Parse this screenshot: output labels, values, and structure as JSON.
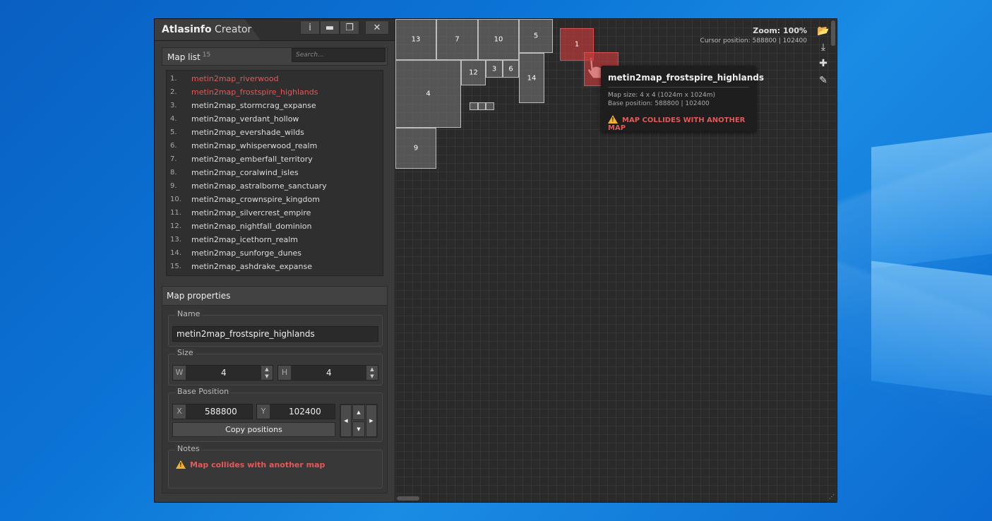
{
  "app": {
    "title_main": "Atlasinfo",
    "title_light": " Creator",
    "buttons": {
      "info": "i",
      "minimize": "▬",
      "restore": "❐",
      "close": "✕"
    }
  },
  "map_list": {
    "title": "Map list",
    "count": "15",
    "search_placeholder": "Search...",
    "items": [
      {
        "num": "1.",
        "name": "metin2map_riverwood"
      },
      {
        "num": "2.",
        "name": "metin2map_frostspire_highlands"
      },
      {
        "num": "3.",
        "name": "metin2map_stormcrag_expanse"
      },
      {
        "num": "4.",
        "name": "metin2map_verdant_hollow"
      },
      {
        "num": "5.",
        "name": "metin2map_evershade_wilds"
      },
      {
        "num": "6.",
        "name": "metin2map_whisperwood_realm"
      },
      {
        "num": "7.",
        "name": "metin2map_emberfall_territory"
      },
      {
        "num": "8.",
        "name": "metin2map_coralwind_isles"
      },
      {
        "num": "9.",
        "name": "metin2map_astralborne_sanctuary"
      },
      {
        "num": "10.",
        "name": "metin2map_crownspire_kingdom"
      },
      {
        "num": "11.",
        "name": "metin2map_silvercrest_empire"
      },
      {
        "num": "12.",
        "name": "metin2map_nightfall_dominion"
      },
      {
        "num": "13.",
        "name": "metin2map_icethorn_realm"
      },
      {
        "num": "14.",
        "name": "metin2map_sunforge_dunes"
      },
      {
        "num": "15.",
        "name": "metin2map_ashdrake_expanse"
      }
    ],
    "error_color": "#e05a5a"
  },
  "props": {
    "title": "Map properties",
    "name_label": "Name",
    "name_value": "metin2map_frostspire_highlands",
    "size_label": "Size",
    "w_label": "W",
    "w_value": "4",
    "h_label": "H",
    "h_value": "4",
    "base_label": "Base Position",
    "x_label": "X",
    "x_value": "588800",
    "y_label": "Y",
    "y_value": "102400",
    "copy_button": "Copy positions",
    "notes_label": "Notes",
    "note_text": "Map collides with another map",
    "arrows": {
      "up": "▲",
      "down": "▼",
      "left": "◀",
      "right": "▶"
    },
    "spin_up": "▲",
    "spin_down": "▼"
  },
  "canvas": {
    "zoom": "Zoom: 100%",
    "cursor_position": "Cursor position: 588800 | 102400",
    "tiles": [
      {
        "label": "13",
        "error": false
      },
      {
        "label": "7",
        "error": false
      },
      {
        "label": "10",
        "error": false
      },
      {
        "label": "5",
        "error": false
      },
      {
        "label": "1",
        "error": true
      },
      {
        "label": "",
        "error": true
      },
      {
        "label": "12",
        "error": false
      },
      {
        "label": "3",
        "error": false
      },
      {
        "label": "6",
        "error": false
      },
      {
        "label": "14",
        "error": false
      },
      {
        "label": "4",
        "error": false
      },
      {
        "label": "",
        "error": false
      },
      {
        "label": "",
        "error": false
      },
      {
        "label": "",
        "error": false
      },
      {
        "label": "9",
        "error": false
      }
    ],
    "tooltip": {
      "title": "metin2map_frostspire_highlands",
      "size": "Map size: 4 x 4 (1024m x 1024m)",
      "base": "Base position: 588800 | 102400",
      "warning": "MAP COLLIDES WITH ANOTHER MAP"
    },
    "tools": [
      {
        "icon": "folder-open-icon",
        "glyph": "📂"
      },
      {
        "icon": "download-icon",
        "glyph": "⤓"
      },
      {
        "icon": "puzzle-icon",
        "glyph": "✚"
      },
      {
        "icon": "broom-icon",
        "glyph": "✎"
      }
    ],
    "grip": "⋰"
  }
}
